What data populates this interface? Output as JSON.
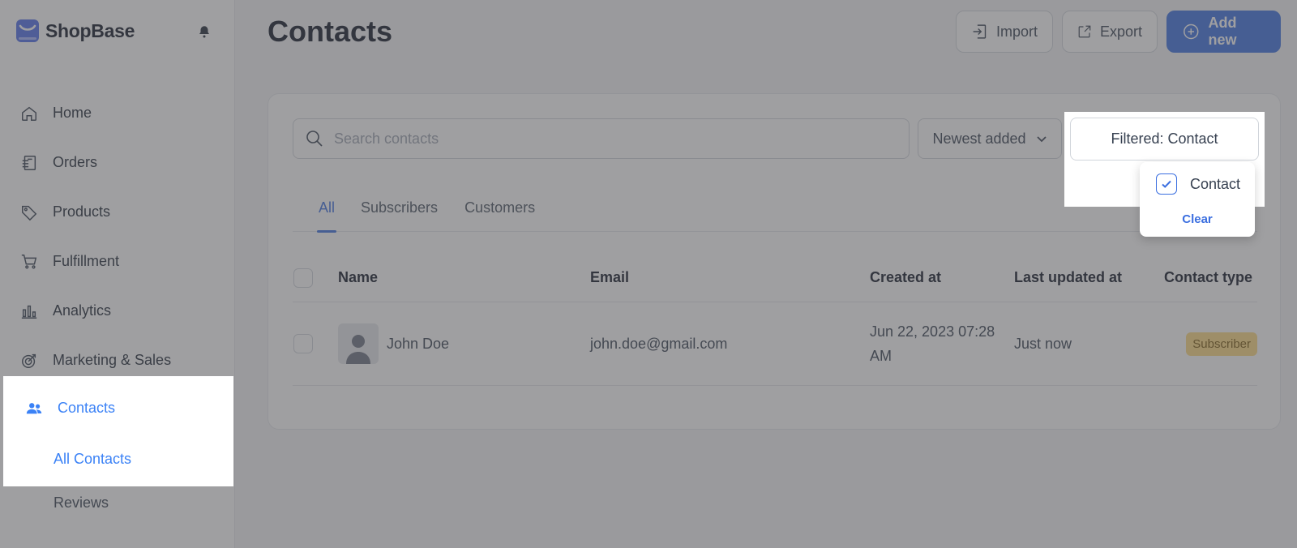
{
  "app": {
    "brand": "ShopBase"
  },
  "sidebar": {
    "items": [
      {
        "label": "Home",
        "icon": "home-icon"
      },
      {
        "label": "Orders",
        "icon": "orders-icon"
      },
      {
        "label": "Products",
        "icon": "tag-icon"
      },
      {
        "label": "Fulfillment",
        "icon": "cart-icon"
      },
      {
        "label": "Analytics",
        "icon": "bar-chart-icon"
      },
      {
        "label": "Marketing & Sales",
        "icon": "target-icon"
      },
      {
        "label": "Contacts",
        "icon": "users-icon",
        "active": true
      }
    ],
    "subitems": [
      {
        "label": "All Contacts",
        "active": true
      },
      {
        "label": "Reviews"
      }
    ]
  },
  "header": {
    "title": "Contacts",
    "import_label": "Import",
    "export_label": "Export",
    "add_label": "Add new"
  },
  "toolbar": {
    "search_placeholder": "Search contacts",
    "sort_label": "Newest added",
    "filter_label": "Filtered: Contact"
  },
  "filter_dropdown": {
    "option_label": "Contact",
    "option_checked": true,
    "clear_label": "Clear"
  },
  "tabs": [
    {
      "label": "All",
      "active": true
    },
    {
      "label": "Subscribers"
    },
    {
      "label": "Customers"
    }
  ],
  "table": {
    "columns": [
      "Name",
      "Email",
      "Created at",
      "Last updated at",
      "Contact type"
    ],
    "rows": [
      {
        "name": "John Doe",
        "email": "john.doe@gmail.com",
        "created_at_line1": "Jun 22, 2023 07:28",
        "created_at_line2": "AM",
        "last_updated": "Just now",
        "contact_type": "Subscriber"
      }
    ]
  },
  "colors": {
    "accent": "#3b6fe0",
    "active_nav": "#3b82f6",
    "badge_bg": "#fcd980",
    "overlay": "rgba(80,80,84,0.55)"
  }
}
